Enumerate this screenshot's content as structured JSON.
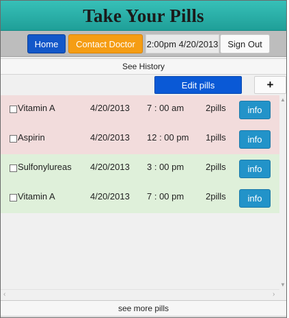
{
  "app": {
    "title": "Take Your Pills"
  },
  "nav": {
    "home_label": "Home",
    "contact_label": "Contact Doctor",
    "datetime": "2:00pm 4/20/2013",
    "signout_label": "Sign Out"
  },
  "history": {
    "label": "See History"
  },
  "toolbar": {
    "edit_label": "Edit pills",
    "add_label": "+"
  },
  "pills": [
    {
      "name": "Vitamin A",
      "date": "4/20/2013",
      "time": "7 : 00 am",
      "qty": "2pills",
      "info_label": "info",
      "status": "red",
      "checked": false
    },
    {
      "name": "Aspirin",
      "date": "4/20/2013",
      "time": "12 : 00 pm",
      "qty": "1pills",
      "info_label": "info",
      "status": "red",
      "checked": false
    },
    {
      "name": "Sulfonylureas",
      "date": "4/20/2013",
      "time": "3 : 00 pm",
      "qty": "2pills",
      "info_label": "info",
      "status": "green",
      "checked": false
    },
    {
      "name": "Vitamin A",
      "date": "4/20/2013",
      "time": "7 : 00 pm",
      "qty": "2pills",
      "info_label": "info",
      "status": "green",
      "checked": false
    }
  ],
  "footer": {
    "more_label": "see more pills"
  },
  "colors": {
    "title_bar": "#2ab3ab",
    "home_button": "#1257c9",
    "contact_button": "#f59d14",
    "edit_button": "#0a59d6",
    "info_button": "#2293c9",
    "row_missed": "#f2dcdc",
    "row_taken": "#dff0da"
  }
}
